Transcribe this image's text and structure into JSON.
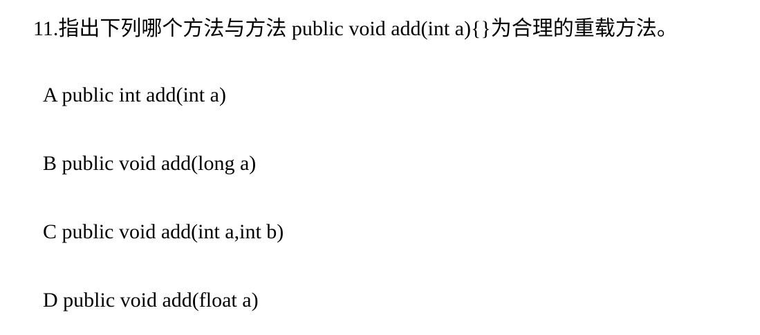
{
  "question": {
    "stem": "11.指出下列哪个方法与方法 public void add(int a){}为合理的重载方法。",
    "options": [
      "A public int add(int a)",
      "B public void add(long a)",
      "C public void add(int a,int b)",
      "D public void add(float a)"
    ]
  }
}
